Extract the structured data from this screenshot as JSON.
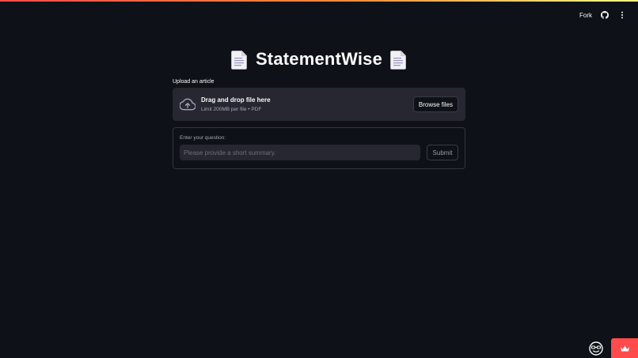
{
  "header": {
    "fork_label": "Fork",
    "icons": [
      "github-icon",
      "more-vertical-icon"
    ]
  },
  "page": {
    "title": "StatementWise",
    "title_icons": [
      "document-icon",
      "document-icon"
    ]
  },
  "uploader": {
    "label": "Upload an article",
    "drop_title": "Drag and drop file here",
    "limits": "Limit 200MB per file • PDF",
    "browse_label": "Browse files",
    "icon": "cloud-upload-icon"
  },
  "question_form": {
    "label": "Enter your question:",
    "input_value": "",
    "placeholder": "Please provide a short summary.",
    "submit_label": "Submit"
  },
  "footer": {
    "icons": [
      "streamlit-face-icon",
      "crown-icon"
    ]
  },
  "colors": {
    "background": "#0e1117",
    "surface": "#262730",
    "accent": "#ff4b4b",
    "text": "#fafafa",
    "muted_text": "#a3a8b8"
  }
}
